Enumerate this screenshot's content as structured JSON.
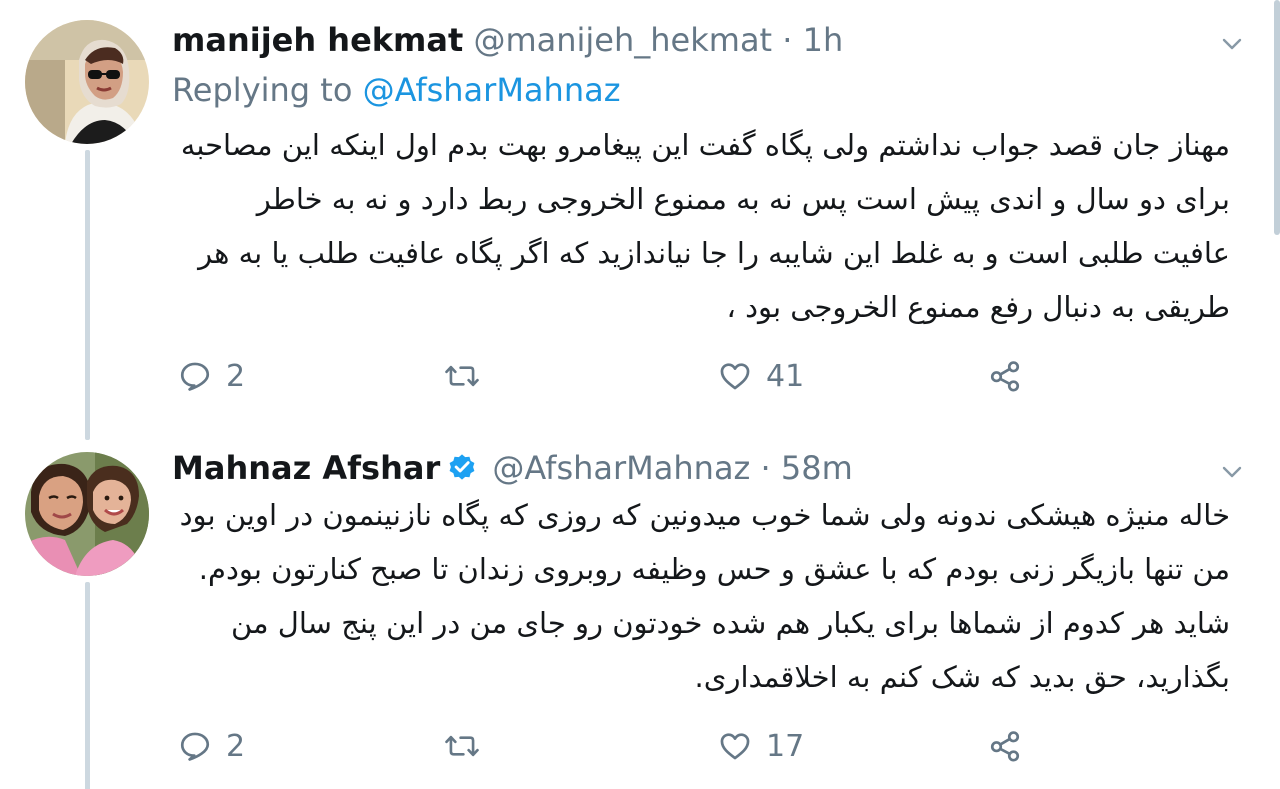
{
  "tweets": [
    {
      "name": "manijeh hekmat",
      "handle": "@manijeh_hekmat",
      "dot": "·",
      "time": "1h",
      "replying_prefix": "Replying to",
      "replying_handle": "@AfsharMahnaz",
      "text": "مهناز جان قصد جواب نداشتم ولی پگاه گفت این پیغامرو بهت بدم اول اینکه این مصاحبه برای دو سال و اندی پیش است پس نه به ممنوع الخروجی ربط دارد و نه به خاطر عافیت طلبی است و به غلط این شایبه را جا نیاندازید که اگر پگاه عافیت طلب یا به هر طریقی به دنبال رفع ممنوع الخروجی بود ،",
      "replies": "2",
      "retweets": "",
      "likes": "41",
      "verified": false,
      "avatar_icon": "woman-sunglasses-headscarf-avatar"
    },
    {
      "name": "Mahnaz Afshar",
      "handle": "@AfsharMahnaz",
      "dot": "·",
      "time": "58m",
      "text": "خاله منیژه هیشکی ندونه ولی شما خوب میدونین که روزی که پگاه نازنینمون در اوین بود من تنها بازیگر زنی بودم که با عشق و حس وظیفه روبروی زندان تا صبح کنارتون بودم. شاید هر کدوم از شماها برای یکبار هم شده خودتون رو جای من در  این پنج سال من بگذارید، حق بدید که شک کنم به اخلاقمداری.",
      "replies": "2",
      "retweets": "",
      "likes": "17",
      "verified": true,
      "avatar_icon": "woman-and-child-avatar"
    }
  ],
  "colors": {
    "text": "#14171a",
    "secondary": "#657786",
    "link": "#1b95e0",
    "thread_line": "#cdd8e0",
    "verified": "#1da1f2"
  },
  "icons": [
    "reply-icon",
    "retweet-icon",
    "like-icon",
    "share-icon",
    "chevron-down-icon",
    "verified-badge-icon"
  ]
}
